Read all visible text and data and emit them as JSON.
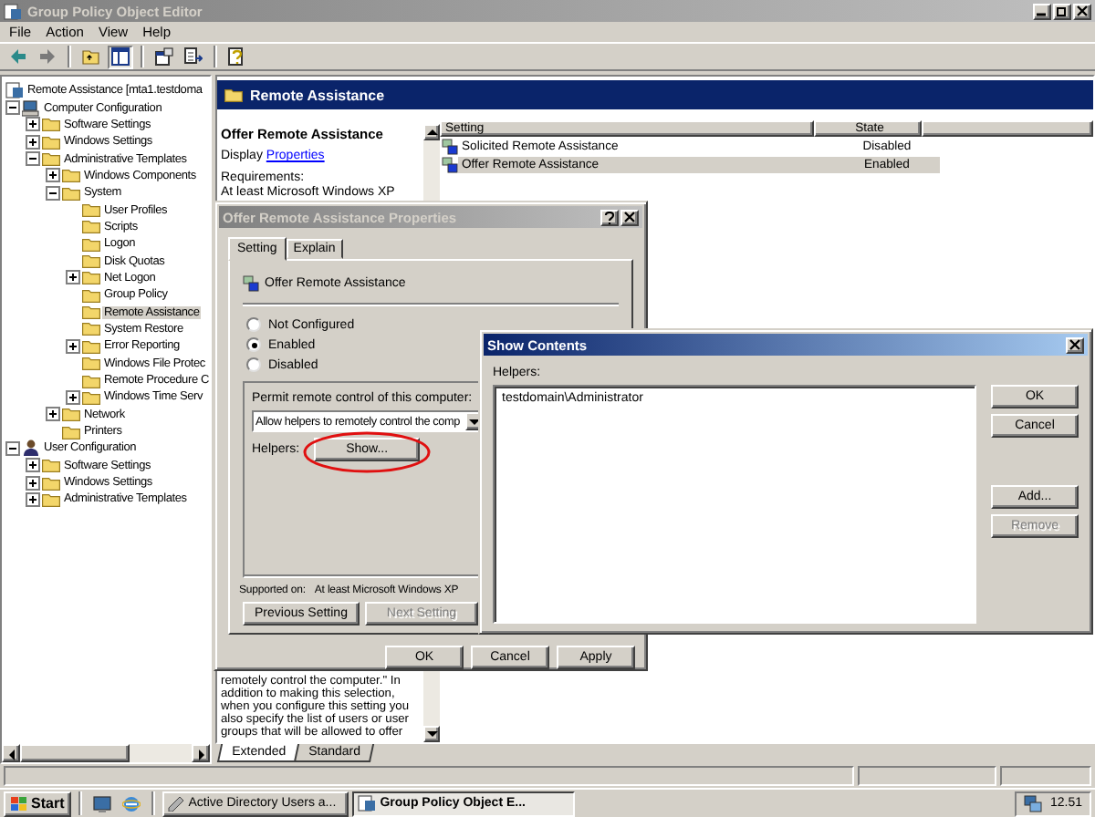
{
  "window": {
    "title": "Group Policy Object Editor"
  },
  "menu": [
    "File",
    "Action",
    "View",
    "Help"
  ],
  "tree": [
    {
      "label": "Remote Assistance [mta1.testdoma",
      "kind": "policy",
      "selected": false,
      "children": [
        {
          "label": "Computer Configuration",
          "kind": "computer",
          "expanded": true,
          "selected": false,
          "children": [
            {
              "label": "Software Settings",
              "kind": "folder",
              "expanded": false,
              "selected": false
            },
            {
              "label": "Windows Settings",
              "kind": "folder",
              "expanded": false,
              "selected": false
            },
            {
              "label": "Administrative Templates",
              "kind": "folder",
              "expanded": true,
              "selected": false,
              "children": [
                {
                  "label": "Windows Components",
                  "kind": "folder",
                  "expanded": false,
                  "selected": false
                },
                {
                  "label": "System",
                  "kind": "folder",
                  "expanded": true,
                  "selected": false,
                  "children": [
                    {
                      "label": "User Profiles",
                      "kind": "folder",
                      "selected": false
                    },
                    {
                      "label": "Scripts",
                      "kind": "folder",
                      "selected": false
                    },
                    {
                      "label": "Logon",
                      "kind": "folder",
                      "selected": false
                    },
                    {
                      "label": "Disk Quotas",
                      "kind": "folder",
                      "selected": false
                    },
                    {
                      "label": "Net Logon",
                      "kind": "folder",
                      "expanded": false,
                      "selected": false
                    },
                    {
                      "label": "Group Policy",
                      "kind": "folder",
                      "selected": false
                    },
                    {
                      "label": "Remote Assistance",
                      "kind": "folder",
                      "selected": true
                    },
                    {
                      "label": "System Restore",
                      "kind": "folder",
                      "selected": false
                    },
                    {
                      "label": "Error Reporting",
                      "kind": "folder",
                      "expanded": false,
                      "selected": false
                    },
                    {
                      "label": "Windows File Protec",
                      "kind": "folder",
                      "selected": false
                    },
                    {
                      "label": "Remote Procedure C",
                      "kind": "folder",
                      "selected": false
                    },
                    {
                      "label": "Windows Time Serv",
                      "kind": "folder",
                      "expanded": false,
                      "selected": false
                    }
                  ]
                },
                {
                  "label": "Network",
                  "kind": "folder",
                  "expanded": false,
                  "selected": false
                },
                {
                  "label": "Printers",
                  "kind": "folder",
                  "selected": false
                }
              ]
            }
          ]
        },
        {
          "label": "User Configuration",
          "kind": "user",
          "expanded": true,
          "selected": false,
          "children": [
            {
              "label": "Software Settings",
              "kind": "folder",
              "expanded": false,
              "selected": false
            },
            {
              "label": "Windows Settings",
              "kind": "folder",
              "expanded": false,
              "selected": false
            },
            {
              "label": "Administrative Templates",
              "kind": "folder",
              "expanded": false,
              "selected": false
            }
          ]
        }
      ]
    }
  ],
  "header": {
    "title": "Remote Assistance"
  },
  "description": {
    "title": "Offer Remote Assistance",
    "display_prefix": "Display",
    "display_link": "Properties",
    "requirements_label": "Requirements:",
    "requirements": "At least Microsoft Windows XP",
    "excerpt": "remotely control the computer.\" In addition to making this selection, when you configure this setting you also specify the list of users or user groups that will be allowed to offer"
  },
  "list": {
    "columns": [
      "Setting",
      "State"
    ],
    "rows": [
      {
        "setting": "Solicited Remote Assistance",
        "state": "Disabled",
        "selected": false
      },
      {
        "setting": "Offer Remote Assistance",
        "state": "Enabled",
        "selected": true
      }
    ]
  },
  "view_tabs": [
    {
      "label": "Extended",
      "selected": true
    },
    {
      "label": "Standard",
      "selected": false
    }
  ],
  "properties_dialog": {
    "title": "Offer Remote Assistance Properties",
    "tabs": [
      {
        "label": "Setting",
        "selected": true
      },
      {
        "label": "Explain",
        "selected": false
      }
    ],
    "policy_name": "Offer Remote Assistance",
    "options": [
      {
        "label": "Not Configured",
        "selected": false
      },
      {
        "label": "Enabled",
        "selected": true
      },
      {
        "label": "Disabled",
        "selected": false
      }
    ],
    "group_label": "Permit remote control of this computer:",
    "dropdown_value": "Allow helpers to remotely control the comp",
    "helpers_label": "Helpers:",
    "show_button": "Show...",
    "supported_label": "Supported on:",
    "supported_value": "At least Microsoft Windows XP",
    "nav_buttons": [
      {
        "label": "Previous Setting",
        "disabled": false
      },
      {
        "label": "Next Setting",
        "disabled": true
      }
    ],
    "buttons": [
      "OK",
      "Cancel",
      "Apply"
    ]
  },
  "show_contents": {
    "title": "Show Contents",
    "label": "Helpers:",
    "items": [
      "testdomain\\Administrator"
    ],
    "buttons": [
      {
        "label": "OK",
        "disabled": false
      },
      {
        "label": "Cancel",
        "disabled": false
      },
      {
        "label": "Add...",
        "disabled": false
      },
      {
        "label": "Remove",
        "disabled": true
      }
    ]
  },
  "taskbar": {
    "start": "Start",
    "tasks": [
      {
        "label": "Active Directory Users a...",
        "selected": false
      },
      {
        "label": "Group Policy Object E...",
        "selected": true
      }
    ],
    "clock": "12.51"
  }
}
